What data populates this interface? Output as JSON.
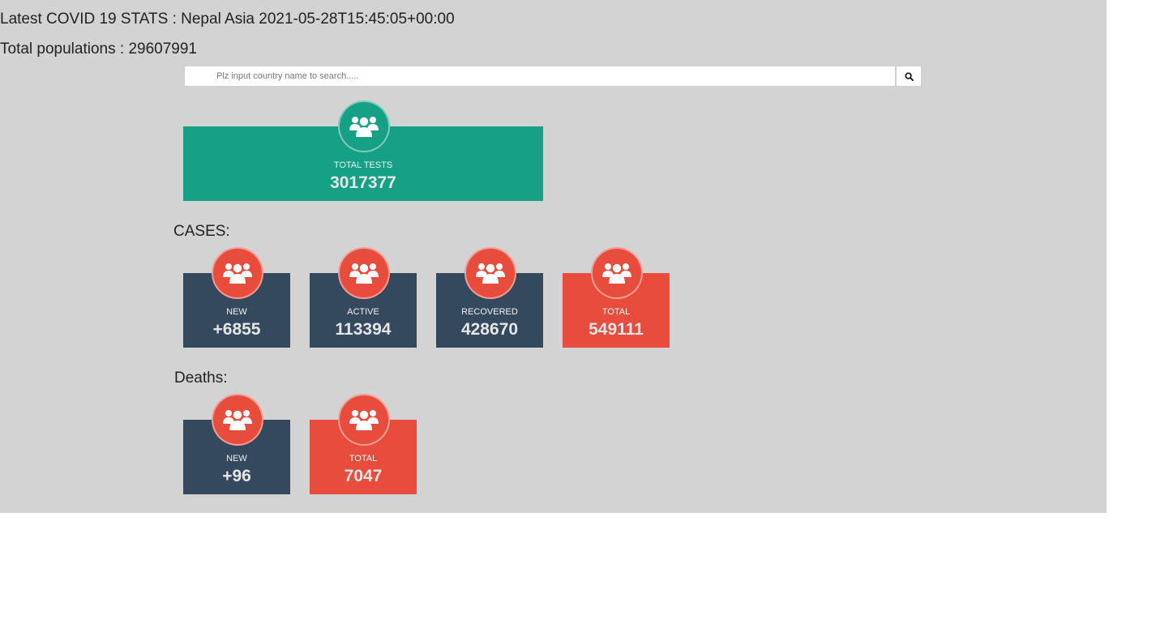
{
  "header": {
    "title": "Latest COVID 19 STATS : Nepal Asia 2021-05-28T15:45:05+00:00",
    "population": "Total populations : 29607991"
  },
  "search": {
    "placeholder": "Plz input country name to search.....",
    "value": "",
    "button_icon": "search-icon"
  },
  "tests": {
    "label": "TOTAL TESTS",
    "value": "3017377",
    "icon": "users-icon"
  },
  "cases": {
    "section_label": "CASES:",
    "cards": [
      {
        "label": "NEW",
        "value": "+6855",
        "icon": "users-icon"
      },
      {
        "label": "ACTIVE",
        "value": "113394",
        "icon": "users-icon"
      },
      {
        "label": "RECOVERED",
        "value": "428670",
        "icon": "users-icon"
      },
      {
        "label": "TOTAL",
        "value": "549111",
        "icon": "users-icon"
      }
    ]
  },
  "deaths": {
    "section_label": "Deaths:",
    "cards": [
      {
        "label": "NEW",
        "value": "+96",
        "icon": "users-icon"
      },
      {
        "label": "TOTAL",
        "value": "7047",
        "icon": "users-icon"
      }
    ]
  },
  "colors": {
    "page_background": "#d3d3d3",
    "dark_card": "#34495e",
    "red_card": "#e74c3c",
    "green_card": "#16a085"
  }
}
